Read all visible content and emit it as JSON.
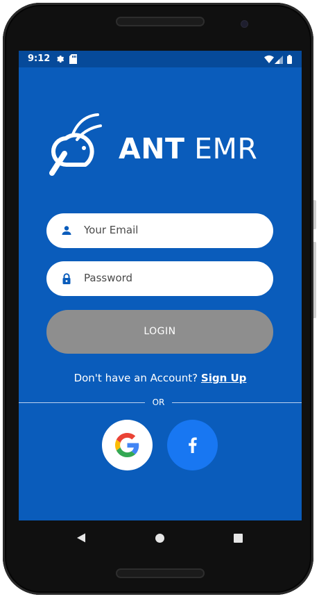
{
  "status_bar": {
    "time": "9:12",
    "left_icons": [
      "gear-icon",
      "sd-card-icon"
    ],
    "right_icons": [
      "wifi-icon",
      "signal-icon",
      "battery-icon"
    ]
  },
  "logo": {
    "text_bold": "ANT",
    "text_light": "EMR",
    "icon": "ant-magnifier-logo"
  },
  "form": {
    "email_placeholder": "Your Email",
    "email_icon": "person-icon",
    "password_placeholder": "Password",
    "password_icon": "lock-icon",
    "login_label": "LOGIN"
  },
  "signup": {
    "prompt": "Don't have an Account?",
    "link": "Sign Up"
  },
  "divider_text": "OR",
  "social": {
    "google_icon": "google-icon",
    "facebook_icon": "facebook-icon"
  },
  "colors": {
    "screen_background": "#0a5cbb",
    "status_bar": "#064a9a",
    "login_button": "#8e8e8e",
    "facebook": "#1877f2"
  },
  "nav_bar": [
    "back-icon",
    "home-icon",
    "recents-icon"
  ]
}
